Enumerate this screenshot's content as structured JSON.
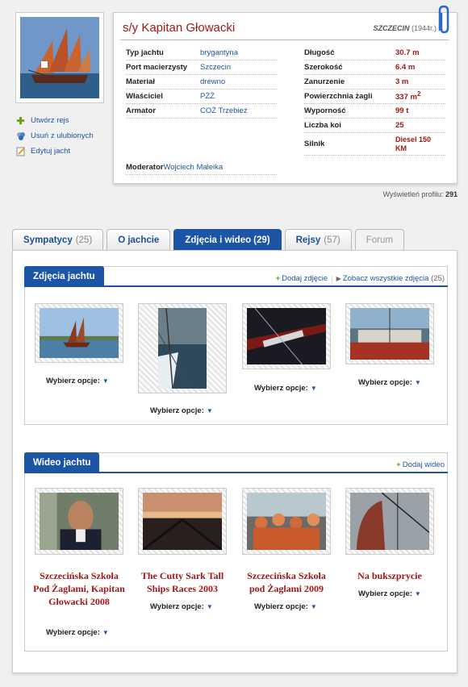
{
  "yacht": {
    "title": "s/y Kapitan Głowacki",
    "home_city": "SZCZECIN",
    "year": "(1944r.)",
    "details_left": [
      {
        "label": "Typ jachtu",
        "value": "brygantyna"
      },
      {
        "label": "Port macierzysty",
        "value": "Szczecin"
      },
      {
        "label": "Materiał",
        "value": "drewno"
      },
      {
        "label": "Właściciel",
        "value": "PŻŻ"
      },
      {
        "label": "Armator",
        "value": "COŻ Trzebież"
      }
    ],
    "details_right": [
      {
        "label": "Długość",
        "value": "30.7 m"
      },
      {
        "label": "Szerokość",
        "value": "6.4 m"
      },
      {
        "label": "Zanurzenie",
        "value": "3 m"
      },
      {
        "label": "Powierzchnia żagli",
        "value": "337 m",
        "sup": "2"
      },
      {
        "label": "Wyporność",
        "value": "99 t"
      },
      {
        "label": "Liczba koi",
        "value": "25"
      },
      {
        "label": "Silnik",
        "value": "Diesel 150 KM"
      }
    ],
    "moderator_label": "Moderator",
    "moderator": "Wojciech Maleika",
    "views_label": "Wyświetleń profilu:",
    "views": "291"
  },
  "actions": [
    {
      "label": "Utwórz rejs",
      "icon": "plus-icon"
    },
    {
      "label": "Usuń z ulubionych",
      "icon": "remove-favorite-icon"
    },
    {
      "label": "Edytuj jacht",
      "icon": "edit-icon"
    }
  ],
  "tabs": [
    {
      "label": "Sympatycy",
      "count": "(25)"
    },
    {
      "label": "O jachcie",
      "count": ""
    },
    {
      "label": "Zdjęcia i wideo",
      "count": "(29)",
      "active": true
    },
    {
      "label": "Rejsy",
      "count": "(57)"
    },
    {
      "label": "Forum",
      "count": ""
    }
  ],
  "photos": {
    "title": "Zdjęcia jachtu",
    "add_link": "Dodaj zdjęcie",
    "all_link": "Zobacz wszystkie zdjęcia",
    "all_count": "(25)",
    "option_label": "Wybierz opcje:"
  },
  "videos": {
    "title": "Wideo jachtu",
    "add_link": "Dodaj wideo",
    "option_label": "Wybierz opcje:",
    "items": [
      {
        "title": "Szczecińska Szkoła Pod Żaglami, Kapitan Głowacki 2008"
      },
      {
        "title": "The Cutty Sark Tall Ships Races 2003"
      },
      {
        "title": "Szczecińska Szkoła pod Żaglami 2009"
      },
      {
        "title": "Na bukszprycie"
      }
    ]
  },
  "colors": {
    "accent": "#1c55a6",
    "title_red": "#a01818",
    "add_green": "#6a9e1a"
  }
}
